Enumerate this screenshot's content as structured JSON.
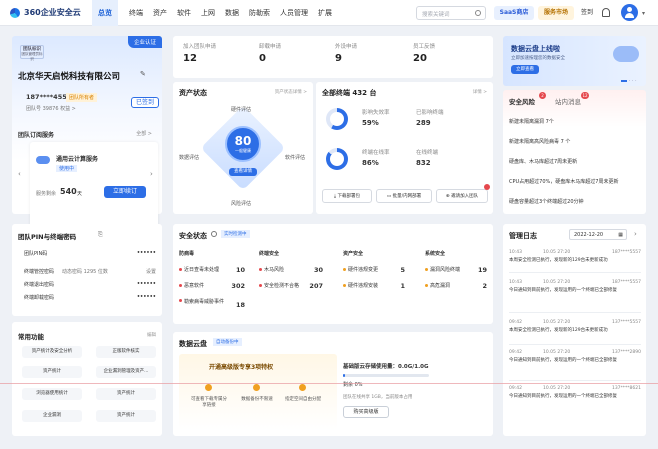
{
  "topbar": {
    "logo": "360企业安全云",
    "nav": [
      "总览",
      "终端",
      "资产",
      "软件",
      "上网",
      "数据",
      "防勒索",
      "人员管理",
      "扩展"
    ],
    "search_placeholder": "搜索关键词",
    "saas": "SaaS商店",
    "market": "服务市场",
    "signin": "签到"
  },
  "org": {
    "badge": "企业认证",
    "tag1": "团队标识",
    "tag2": "团队管理员标识",
    "name": "北京华天启悦科技有限公司",
    "phone": "187****4557",
    "role": "团队所有者",
    "team_no": "团队号 39876 权益 >",
    "team_status": "已签到",
    "subs_title": "团队订阅服务",
    "subs_all": "全部 >",
    "service": "通用云计算服务",
    "service_status": "使用中",
    "remain_label": "服务剩余",
    "remain_value": "540",
    "remain_unit": "天",
    "renew": "立即续订"
  },
  "stats": [
    {
      "label": "加入团队申请",
      "value": "12"
    },
    {
      "label": "卸载申请",
      "value": "0"
    },
    {
      "label": "外设申请",
      "value": "9"
    },
    {
      "label": "员工反馈",
      "value": "20"
    }
  ],
  "asset": {
    "title": "资产状态",
    "link": "资产状态详情 >",
    "score": "80",
    "level": "一般健康",
    "check": "查看详情",
    "labels": [
      "硬件评估",
      "软件评估",
      "风险评估",
      "数据评估"
    ]
  },
  "terminals": {
    "title": "全部终端 432 台",
    "detail": "详情 >",
    "items": [
      {
        "label": "影响失效率",
        "value": "59%"
      },
      {
        "label": "已影响终端",
        "value": "289"
      },
      {
        "label": "终端在线率",
        "value": "86%"
      },
      {
        "label": "在线终端",
        "value": "832"
      }
    ],
    "actions": [
      "下载部署包",
      "批量/内网部署",
      "邀请加入团队"
    ]
  },
  "banner": {
    "title": "数据云盘上线啦",
    "sub": "立即加速按理您的数据安全",
    "btn": "立即查看"
  },
  "risk": {
    "tab1": "安全风险",
    "tab2": "站内消息",
    "badge1": "2",
    "badge2": "12",
    "items": [
      "新建未隔离漏洞 7个",
      "新建未隔离高风险病毒 7 个",
      "硬盘库、木马库超过7周未更新",
      "CPU占用超过70%，硬盘库木马库超过7周未更新",
      "硬盘容量超过3个终端超过20分钟"
    ]
  },
  "pin": {
    "title": "团队PIN与终端密码",
    "rows": [
      {
        "label": "团队PIN码",
        "value": "••••••"
      },
      {
        "label": "终端管控密码",
        "value": "动态密码  1295 位数",
        "action": "设置"
      },
      {
        "label": "终端退出密码",
        "value": "••••••"
      },
      {
        "label": "终端卸载密码",
        "value": "••••••"
      }
    ]
  },
  "funcs": {
    "title": "常用功能",
    "manage": "编辑",
    "items": [
      "资产统计及安全分析",
      "正版软件核实",
      "资产统计",
      "企业漏洞管理及资产...",
      "浏览器使用统计",
      "资产统计",
      "企业漏洞",
      "资产统计"
    ]
  },
  "sec": {
    "title": "安全状态",
    "tag": "实时检测中",
    "cols": [
      {
        "head": "防病毒",
        "rows": [
          {
            "label": "近日查毒未处理",
            "value": "10"
          },
          {
            "label": "恶意软件",
            "value": "302"
          },
          {
            "label": "勒索病毒威胁事件",
            "value": "18"
          }
        ]
      },
      {
        "head": "终端安全",
        "rows": [
          {
            "label": "木马风险",
            "value": "30"
          },
          {
            "label": "安全检测不合格",
            "value": "207"
          }
        ]
      },
      {
        "head": "资产安全",
        "rows": [
          {
            "label": "硬件违规变更",
            "value": "5"
          },
          {
            "label": "硬件违规安装",
            "value": "1"
          }
        ]
      },
      {
        "head": "系统安全",
        "rows": [
          {
            "label": "漏洞风险终端",
            "value": "19"
          },
          {
            "label": "高危漏洞",
            "value": "2"
          }
        ]
      }
    ]
  },
  "cloud": {
    "title": "数据云盘",
    "tag": "自动备份中",
    "promo": "开通高级版专享3项特权",
    "features": [
      "可查看下载专属分享链接",
      "数据备份不限速",
      "指定空间自由分配"
    ],
    "usage_title": "基础版云存储使用量：0.0G/1.0G",
    "usage_pct": "剩余 0%",
    "usage_fill": 0.02,
    "usage_note": "团队在线共享 1GB，当前版本占用",
    "upgrade": "购买高级版"
  },
  "log": {
    "title": "管理日志",
    "date": "2022-12-20",
    "entries": [
      {
        "time": "10:43",
        "date": "10.05 27:20",
        "who": "187****5557",
        "text": "本周安全检测已执行，发现新的129台未更新成功"
      },
      {
        "time": "10:43",
        "date": "10.05 27:20",
        "who": "187****5557",
        "text": "今日通知到目前执行，发现运用的一个终端已全部修复"
      },
      {
        "time": "09:42",
        "date": "10.05 27:20",
        "who": "137****5557",
        "text": "本周安全检测已执行，发现新的129台未更新成功"
      },
      {
        "time": "09:42",
        "date": "10.05 27:20",
        "who": "137****2890",
        "text": "今日通知到目前执行，发现运用的一个终端已全部修复"
      },
      {
        "time": "09:42",
        "date": "10.05 27:20",
        "who": "137****8621",
        "text": "今日通知到目前执行，发现运用的一个终端已全部修复"
      }
    ]
  }
}
